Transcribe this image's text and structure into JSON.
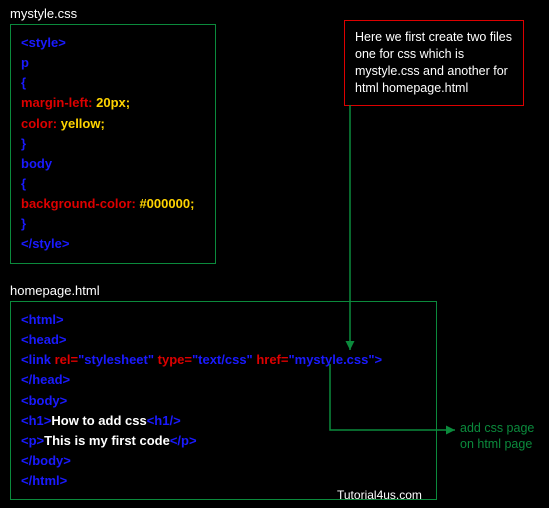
{
  "file1": {
    "name": "mystyle.css",
    "code": {
      "l1": "<style>",
      "l2": "p",
      "l3": "{",
      "l4_prop": "margin-left:",
      "l4_val": " 20px;",
      "l5_prop": "color:",
      "l5_val": " yellow;",
      "l6": "}",
      "l7": "body",
      "l8": "{",
      "l9_prop": "background-color:",
      "l9_val": " #000000;",
      "l10": "}",
      "l11": "</style>"
    }
  },
  "file2": {
    "name": "homepage.html",
    "code": {
      "l1": "<html>",
      "l2": "<head>",
      "link_open": "<link ",
      "link_attr1": "rel=",
      "link_val1": "\"stylesheet\" ",
      "link_attr2": "type=",
      "link_val2": "\"text/css\" ",
      "link_attr3": "href=",
      "link_val3": "\"mystyle.css\"",
      "link_close": ">",
      "l4": "</head>",
      "l5": "<body>",
      "l6_o": "<h1>",
      "l6_txt": "How to add css",
      "l6_c": "<h1/>",
      "l7_o": "<p>",
      "l7_txt": "This is my first code",
      "l7_c": "</p>",
      "l8": "</body>",
      "l9": "</html>"
    }
  },
  "note": "Here we first create two files one for css which is mystyle.css and another for html homepage.html",
  "annotation": "add css page\non html page",
  "watermark": "Tutorial4us.com"
}
